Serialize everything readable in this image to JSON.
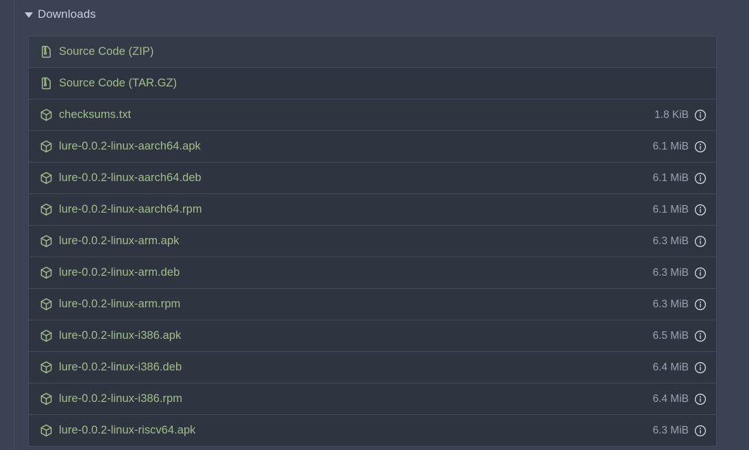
{
  "section": {
    "title": "Downloads",
    "expanded": true,
    "disclosure_icon": "triangle-down-icon"
  },
  "colors": {
    "page_background": "#3b4252",
    "row_background": "#2e3440",
    "row_hover_background": "#333a48",
    "row_border": "#434c5e",
    "link_green": "#a3be8c",
    "size_text": "#9aa3b5",
    "title_text": "#c8cedb"
  },
  "downloads": [
    {
      "name": "Source Code (ZIP)",
      "icon": "file-zip-icon",
      "size": "",
      "has_info": false,
      "hovered": true
    },
    {
      "name": "Source Code (TAR.GZ)",
      "icon": "file-zip-icon",
      "size": "",
      "has_info": false,
      "hovered": false
    },
    {
      "name": "checksums.txt",
      "icon": "package-icon",
      "size": "1.8 KiB",
      "has_info": true,
      "hovered": false
    },
    {
      "name": "lure-0.0.2-linux-aarch64.apk",
      "icon": "package-icon",
      "size": "6.1 MiB",
      "has_info": true,
      "hovered": false
    },
    {
      "name": "lure-0.0.2-linux-aarch64.deb",
      "icon": "package-icon",
      "size": "6.1 MiB",
      "has_info": true,
      "hovered": false
    },
    {
      "name": "lure-0.0.2-linux-aarch64.rpm",
      "icon": "package-icon",
      "size": "6.1 MiB",
      "has_info": true,
      "hovered": false
    },
    {
      "name": "lure-0.0.2-linux-arm.apk",
      "icon": "package-icon",
      "size": "6.3 MiB",
      "has_info": true,
      "hovered": false
    },
    {
      "name": "lure-0.0.2-linux-arm.deb",
      "icon": "package-icon",
      "size": "6.3 MiB",
      "has_info": true,
      "hovered": false
    },
    {
      "name": "lure-0.0.2-linux-arm.rpm",
      "icon": "package-icon",
      "size": "6.3 MiB",
      "has_info": true,
      "hovered": false
    },
    {
      "name": "lure-0.0.2-linux-i386.apk",
      "icon": "package-icon",
      "size": "6.5 MiB",
      "has_info": true,
      "hovered": false
    },
    {
      "name": "lure-0.0.2-linux-i386.deb",
      "icon": "package-icon",
      "size": "6.4 MiB",
      "has_info": true,
      "hovered": false
    },
    {
      "name": "lure-0.0.2-linux-i386.rpm",
      "icon": "package-icon",
      "size": "6.4 MiB",
      "has_info": true,
      "hovered": false
    },
    {
      "name": "lure-0.0.2-linux-riscv64.apk",
      "icon": "package-icon",
      "size": "6.3 MiB",
      "has_info": true,
      "hovered": false
    }
  ]
}
